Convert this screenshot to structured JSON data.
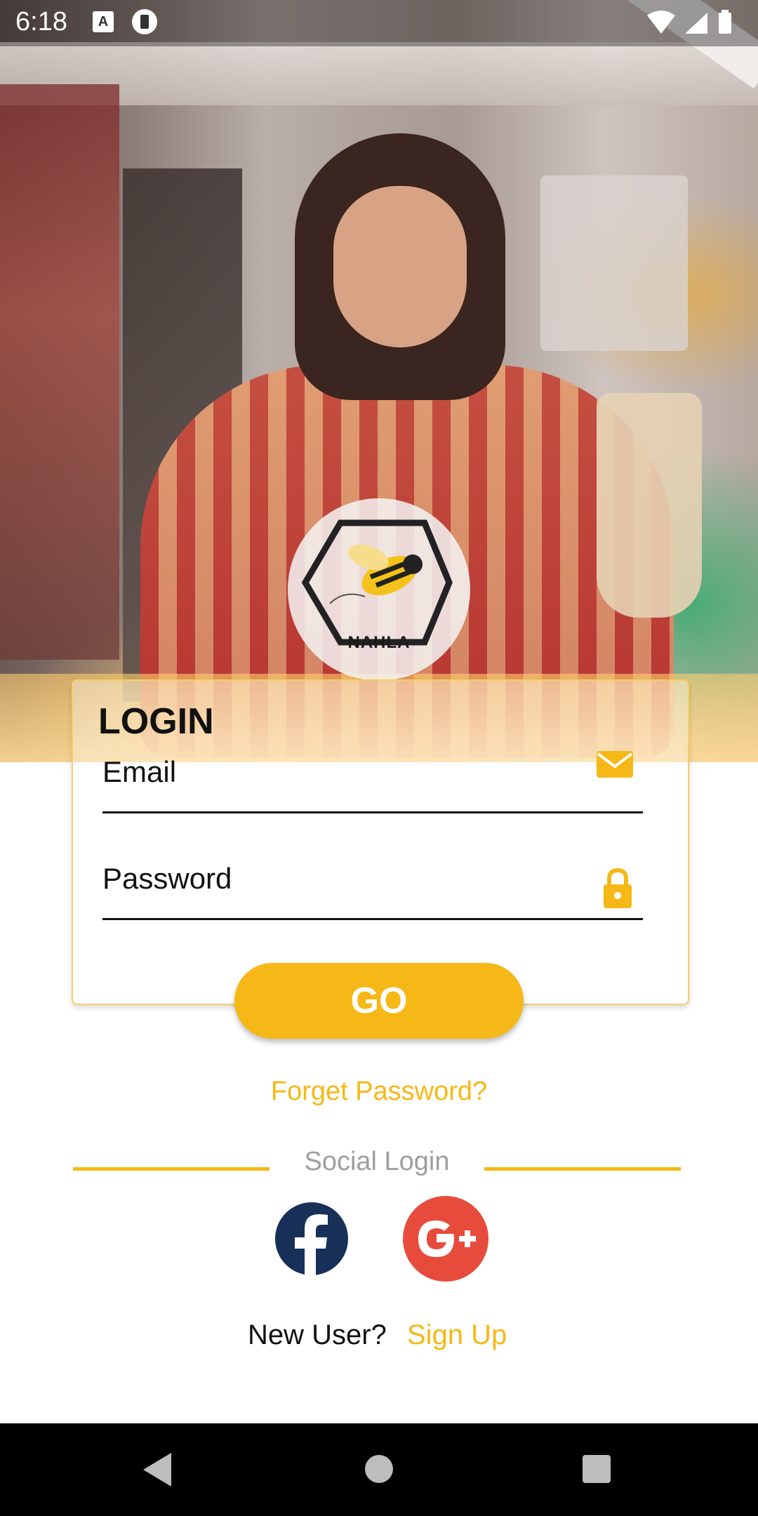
{
  "status_bar": {
    "time": "6:18",
    "notification_icon_a": "A",
    "icons": [
      "wifi-icon",
      "signal-icon",
      "battery-icon"
    ]
  },
  "hero": {
    "image_description_icon": "hero-photo"
  },
  "logo": {
    "text": "NAHLA"
  },
  "login": {
    "title": "LOGIN",
    "email_label": "Email",
    "password_label": "Password",
    "go_label": "GO",
    "forget_password": "Forget Password?"
  },
  "social": {
    "label": "Social Login",
    "facebook_icon": "facebook-icon",
    "google_plus_icon": "google-plus-icon"
  },
  "footer": {
    "new_user": "New User?",
    "sign_up": "Sign Up"
  },
  "colors": {
    "accent": "#f6b816",
    "facebook": "#173058",
    "google": "#e74b3c"
  }
}
